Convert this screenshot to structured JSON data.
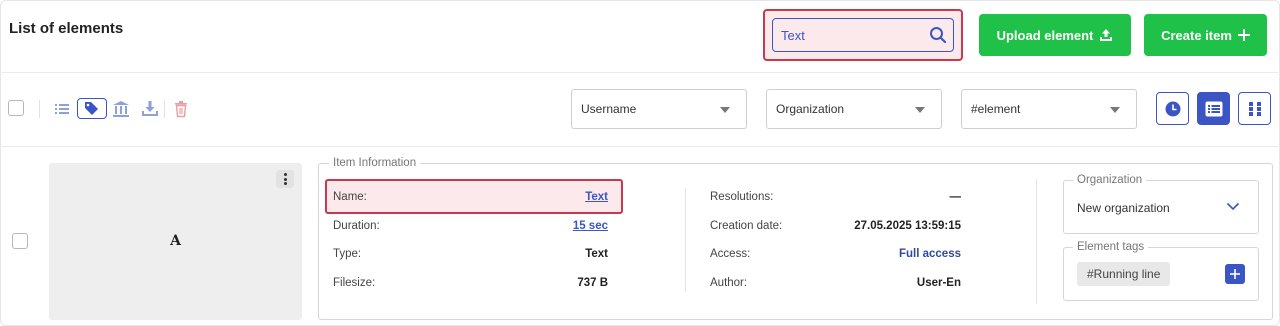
{
  "header": {
    "title": "List of elements",
    "search": {
      "value": "Text",
      "placeholder": ""
    },
    "upload_label": "Upload element",
    "create_label": "Create item"
  },
  "filters": {
    "username": "Username",
    "organization": "Organization",
    "element": "#element"
  },
  "item": {
    "thumbnail_letter": "A",
    "info_legend": "Item Information",
    "left_fields": [
      {
        "label": "Name:",
        "value": "Text"
      },
      {
        "label": "Duration:",
        "value": "15 sec"
      },
      {
        "label": "Type:",
        "value": "Text"
      },
      {
        "label": "Filesize:",
        "value": "737 B"
      }
    ],
    "right_fields": [
      {
        "label": "Resolutions:",
        "value": "—"
      },
      {
        "label": "Creation date:",
        "value": "27.05.2025 13:59:15"
      },
      {
        "label": "Access:",
        "value": "Full access"
      },
      {
        "label": "Author:",
        "value": "User-En"
      }
    ],
    "organization_legend": "Organization",
    "organization_value": "New organization",
    "tags_legend": "Element tags",
    "tags": [
      "#Running line"
    ]
  },
  "colors": {
    "accent": "#3b56c4",
    "green": "#1fc148",
    "highlight_border": "#c8384f",
    "highlight_bg": "#fbe9ec"
  }
}
